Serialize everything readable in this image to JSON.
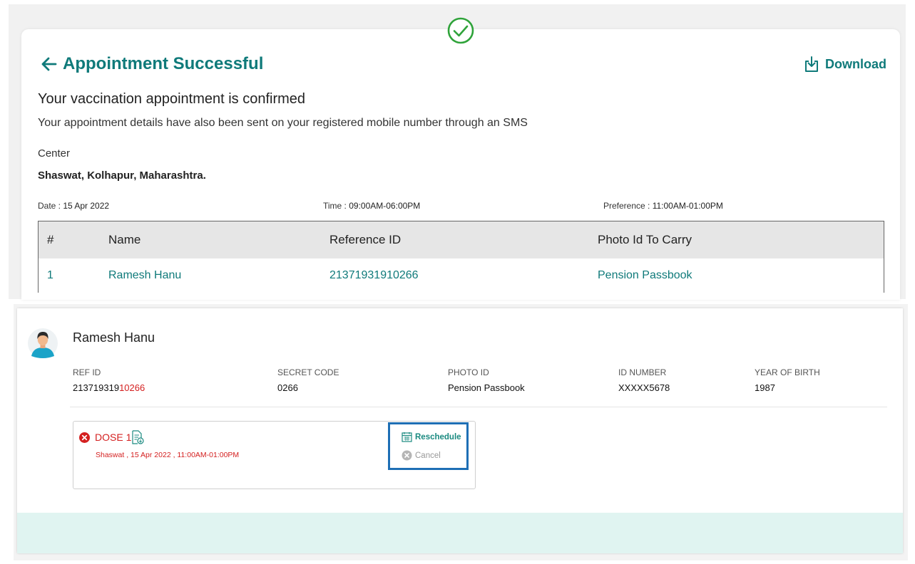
{
  "header": {
    "title": "Appointment Successful",
    "download_label": "Download"
  },
  "confirmation": {
    "heading": "Your vaccination appointment is confirmed",
    "subtext": "Your appointment details have also been sent on your registered mobile number through an SMS",
    "center_label": "Center",
    "center_value": "Shaswat, Kolhapur, Maharashtra."
  },
  "schedule": {
    "date_label": "Date :",
    "date_value": "15 Apr 2022",
    "time_label": "Time :",
    "time_value": "09:00AM-06:00PM",
    "preference_label": "Preference :",
    "preference_value": "11:00AM-01:00PM"
  },
  "table": {
    "headers": [
      "#",
      "Name",
      "Reference ID",
      "Photo Id To Carry"
    ],
    "rows": [
      [
        "1",
        "Ramesh Hanu",
        "21371931910266",
        "Pension Passbook"
      ]
    ]
  },
  "beneficiary": {
    "name": "Ramesh Hanu",
    "ref_id_label": "REF ID",
    "ref_id_prefix": "213719319",
    "ref_id_suffix": "10266",
    "secret_code_label": "SECRET CODE",
    "secret_code": "0266",
    "photo_id_label": "PHOTO ID",
    "photo_id": "Pension Passbook",
    "id_number_label": "ID NUMBER",
    "id_number": "XXXXX5678",
    "yob_label": "YEAR OF BIRTH",
    "yob": "1987"
  },
  "dose": {
    "title": "DOSE 1",
    "detail": "Shaswat , 15 Apr 2022 , 11:00AM-01:00PM",
    "reschedule_label": "Reschedule",
    "cancel_label": "Cancel"
  },
  "colors": {
    "accent": "#0f7a7a",
    "alert": "#d42020",
    "highlight_box": "#1e6fb5",
    "footer_tint": "#e0f4f1"
  },
  "icons": [
    "check-circle-icon",
    "back-arrow-icon",
    "download-icon",
    "avatar-icon",
    "x-circle-icon",
    "document-icon",
    "calendar-icon",
    "cancel-icon"
  ]
}
